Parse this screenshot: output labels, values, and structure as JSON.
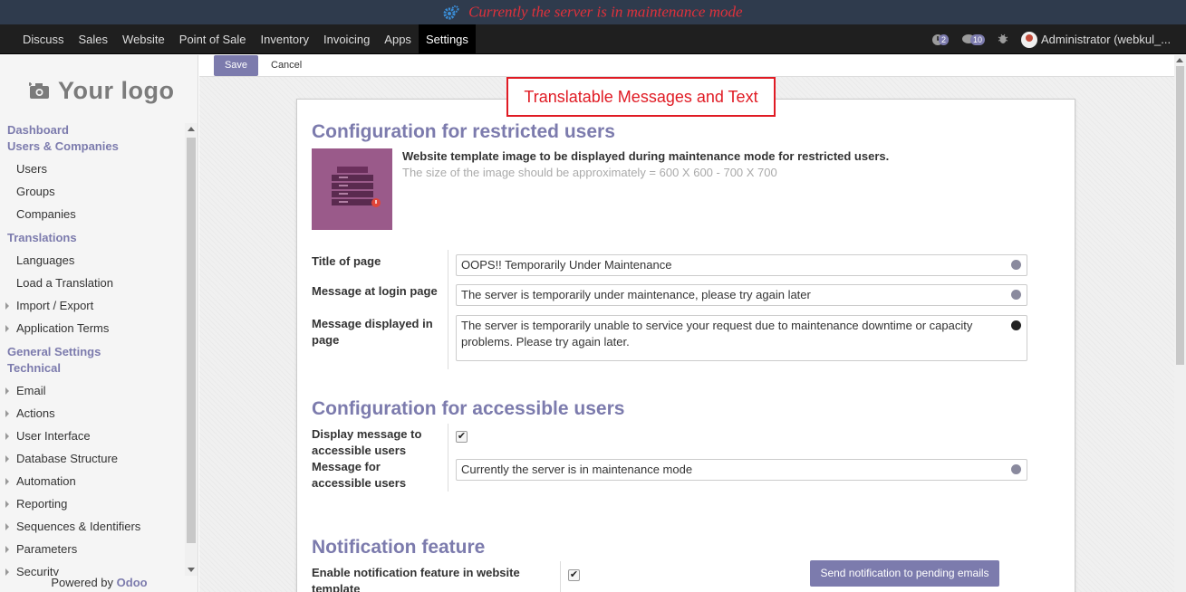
{
  "banner": {
    "message": "Currently the server is in maintenance mode",
    "icon": "gears-icon"
  },
  "menu": {
    "items": [
      "Discuss",
      "Sales",
      "Website",
      "Point of Sale",
      "Inventory",
      "Invoicing",
      "Apps",
      "Settings"
    ],
    "active": "Settings"
  },
  "systray": {
    "activity_count": "2",
    "messages_count": "10",
    "user_name": "Administrator (webkul_..."
  },
  "sidebar": {
    "logo_text": "Your logo",
    "powered_by": "Powered by",
    "powered_brand": "Odoo",
    "items": [
      {
        "type": "cat",
        "label": "Dashboard"
      },
      {
        "type": "cat",
        "label": "Users & Companies"
      },
      {
        "type": "sub",
        "label": "Users"
      },
      {
        "type": "sub",
        "label": "Groups"
      },
      {
        "type": "sub",
        "label": "Companies"
      },
      {
        "type": "cat",
        "label": "Translations"
      },
      {
        "type": "sub",
        "label": "Languages"
      },
      {
        "type": "sub",
        "label": "Load a Translation"
      },
      {
        "type": "subcaret",
        "label": "Import / Export"
      },
      {
        "type": "subcaret",
        "label": "Application Terms"
      },
      {
        "type": "cat",
        "label": "General Settings"
      },
      {
        "type": "cat",
        "label": "Technical"
      },
      {
        "type": "subcaret",
        "label": "Email"
      },
      {
        "type": "subcaret",
        "label": "Actions"
      },
      {
        "type": "subcaret",
        "label": "User Interface"
      },
      {
        "type": "subcaret",
        "label": "Database Structure"
      },
      {
        "type": "subcaret",
        "label": "Automation"
      },
      {
        "type": "subcaret",
        "label": "Reporting"
      },
      {
        "type": "subcaret",
        "label": "Sequences & Identifiers"
      },
      {
        "type": "subcaret",
        "label": "Parameters"
      },
      {
        "type": "subcaret",
        "label": "Security"
      }
    ]
  },
  "control_panel": {
    "save_label": "Save",
    "cancel_label": "Cancel"
  },
  "annotation": {
    "text": "Translatable Messages and Text"
  },
  "restricted": {
    "heading": "Configuration for restricted users",
    "image_desc": "Website template image to be displayed during maintenance mode for restricted users.",
    "image_hint": "The size of the image should be approximately = 600 X 600 - 700 X 700",
    "title_label": "Title of page",
    "title_value": "OOPS!! Temporarily Under Maintenance",
    "login_label": "Message at login page",
    "login_value": "The server is temporarily under maintenance, please try again later",
    "page_label": "Message displayed in page",
    "page_value": "The server is temporarily unable to service your request due to maintenance downtime or capacity problems. Please try again later."
  },
  "accessible": {
    "heading": "Configuration for accessible users",
    "display_label": "Display message to accessible users",
    "display_checked": true,
    "message_label": "Message for accessible users",
    "message_value": "Currently the server is in maintenance mode"
  },
  "notification": {
    "heading": "Notification feature",
    "enable_label": "Enable notification feature in website template",
    "enable_checked": true,
    "send_label": "Send notification to pending emails"
  },
  "colors": {
    "accent": "#7c7bad",
    "banner_bg": "#2f3b4d",
    "banner_text": "#e0313b",
    "annotation": "#e01b24"
  }
}
